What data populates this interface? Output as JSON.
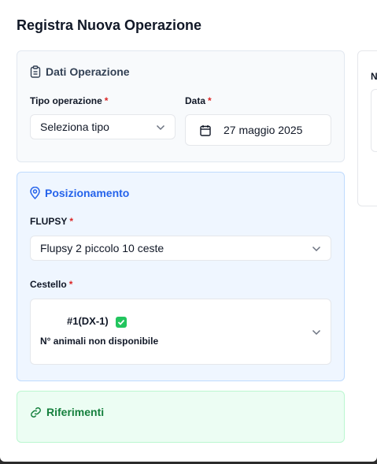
{
  "dialog": {
    "title": "Registra Nuova Operazione"
  },
  "dati_operazione": {
    "title": "Dati Operazione",
    "tipo_label": "Tipo operazione",
    "tipo_placeholder": "Seleziona tipo",
    "data_label": "Data",
    "data_value": "27 maggio 2025",
    "required_mark": "*"
  },
  "posizionamento": {
    "title": "Posizionamento",
    "flupsy_label": "FLUPSY",
    "flupsy_value": "Flupsy 2 piccolo 10 ceste",
    "cestello_label": "Cestello",
    "cestello_value": "#1(DX-1)",
    "cestello_sub": "N° animali non disponibile",
    "required_mark": "*"
  },
  "riferimenti": {
    "title": "Riferimenti"
  },
  "side_panel": {
    "label": "N"
  },
  "colors": {
    "blue_accent": "#2563eb",
    "green_accent": "#15803d",
    "required": "#dc2626"
  }
}
